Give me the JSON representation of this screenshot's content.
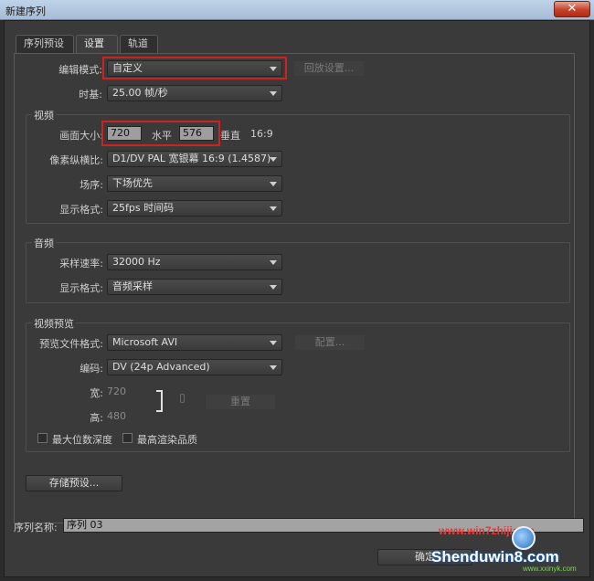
{
  "window": {
    "title": "新建序列",
    "close_glyph": "✕"
  },
  "tabs": [
    {
      "label": "序列预设"
    },
    {
      "label": "设置"
    },
    {
      "label": "轨道"
    }
  ],
  "settings": {
    "edit_mode": {
      "label": "编辑模式:",
      "value": "自定义"
    },
    "playback_button": "回放设置...",
    "timebase": {
      "label": "时基:",
      "value": "25.00 帧/秒"
    }
  },
  "video": {
    "group_title": "视频",
    "frame_size_label": "画面大小:",
    "width_value": "720",
    "horizontal_label": "水平",
    "height_value": "576",
    "vertical_label": "垂直",
    "aspect": "16:9",
    "pixel_aspect": {
      "label": "像素纵横比:",
      "value": "D1/DV PAL 宽银幕 16:9 (1.4587)"
    },
    "fields": {
      "label": "场序:",
      "value": "下场优先"
    },
    "display_format": {
      "label": "显示格式:",
      "value": "25fps 时间码"
    }
  },
  "audio": {
    "group_title": "音频",
    "sample_rate": {
      "label": "采样速率:",
      "value": "32000 Hz"
    },
    "display_format": {
      "label": "显示格式:",
      "value": "音频采样"
    }
  },
  "preview": {
    "group_title": "视频预览",
    "file_format": {
      "label": "预览文件格式:",
      "value": "Microsoft AVI"
    },
    "config_button": "配置...",
    "codec": {
      "label": "编码:",
      "value": "DV (24p Advanced)"
    },
    "width_label": "宽:",
    "width_value": "720",
    "height_label": "高:",
    "height_value": "480",
    "reset_button": "重置",
    "max_bit_depth": "最大位数深度",
    "max_render_quality": "最高渲染品质"
  },
  "save_preset_button": "存储预设...",
  "sequence_name": {
    "label": "序列名称:",
    "value": "序列 03"
  },
  "ok_button": "确定",
  "watermark": {
    "url": "www.win7zhijia.cn",
    "brand": "Shenduwin8.com",
    "small": "www.xxinyk.com"
  },
  "colors": {
    "highlight": "#d02020",
    "panel": "#3a3a3a"
  }
}
